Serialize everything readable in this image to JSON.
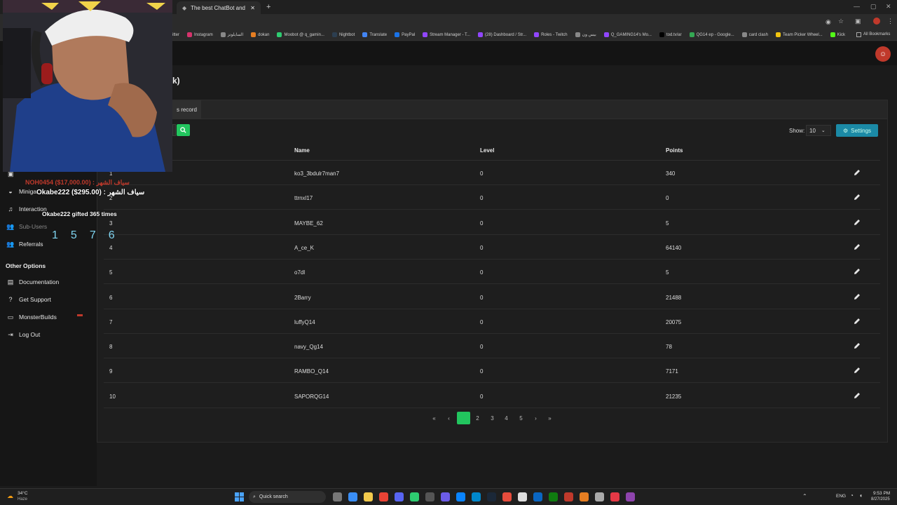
{
  "browser": {
    "tab_title": "The best ChatBot and Widgets",
    "bookmarks": [
      "itter",
      "Instagram",
      "السايلوتز",
      "dokan",
      "Moobot @ q_gamin...",
      "Nightbot",
      "Translate",
      "PayPal",
      "Stream Manager - T...",
      "(28) Dashboard / Str...",
      "Roles - Twitch",
      "بيس ون",
      "Q_GAMING14's Mo...",
      "tod.tv/ar",
      "QG14 ep - Google...",
      "card clash",
      "Team Picker Wheel...",
      "Kick"
    ],
    "all_bookmarks": "All Bookmarks"
  },
  "page": {
    "title_fragment": "k)",
    "tab_fragment": "s record"
  },
  "sidebar": {
    "items": [
      {
        "label": "Minigames",
        "icon": "gamepad-icon"
      },
      {
        "label": "Interaction",
        "icon": "music-icon"
      },
      {
        "label": "Sub-Users",
        "icon": "users-icon"
      },
      {
        "label": "Referrals",
        "icon": "users-icon"
      }
    ],
    "section": "Other Options",
    "other": [
      {
        "label": "Documentation",
        "icon": "book-icon"
      },
      {
        "label": "Get Support",
        "icon": "question-icon"
      },
      {
        "label": "MonsterBuilds",
        "icon": "laptop-icon"
      },
      {
        "label": "Log Out",
        "icon": "logout-icon"
      }
    ]
  },
  "toolbar": {
    "show_label": "Show:",
    "show_value": "10",
    "settings_label": "Settings"
  },
  "table": {
    "headers": {
      "name": "Name",
      "level": "Level",
      "points": "Points"
    },
    "rows": [
      {
        "rank": "1",
        "name": "ko3_3bdulr7man7",
        "level": "0",
        "points": "340"
      },
      {
        "rank": "2",
        "name": "ttrnxl17",
        "level": "0",
        "points": "0"
      },
      {
        "rank": "3",
        "name": "MAYBE_62",
        "level": "0",
        "points": "5"
      },
      {
        "rank": "4",
        "name": "A_ce_K",
        "level": "0",
        "points": "64140"
      },
      {
        "rank": "5",
        "name": "o7dl",
        "level": "0",
        "points": "5"
      },
      {
        "rank": "6",
        "name": "2Barry",
        "level": "0",
        "points": "21488"
      },
      {
        "rank": "7",
        "name": "luffyQ14",
        "level": "0",
        "points": "20075"
      },
      {
        "rank": "8",
        "name": "navy_Qg14",
        "level": "0",
        "points": "78"
      },
      {
        "rank": "9",
        "name": "RAMBO_Q14",
        "level": "0",
        "points": "7171"
      },
      {
        "rank": "10",
        "name": "SAPORQG14",
        "level": "0",
        "points": "21235"
      }
    ]
  },
  "pagination": {
    "first": "«",
    "prev": "‹",
    "pages": [
      "1",
      "2",
      "3",
      "4",
      "5"
    ],
    "current": "1",
    "next": "›",
    "last": "»"
  },
  "overlay": {
    "top_line": "NOH0454 ($17,000.00) : سياف الشهر",
    "main_line": "Okabe222 ($295.00) : سياف الشهر",
    "gifted_line": "Okabe222 gifted 365 times",
    "counter": [
      "1",
      "5",
      "7",
      "6"
    ]
  },
  "taskbar": {
    "weather_temp": "34°C",
    "weather_desc": "Haze",
    "search": "Quick search",
    "lang": "ENG",
    "time": "9:53 PM",
    "date": "8/27/2025"
  },
  "colors": {
    "accent_green": "#22c55e",
    "settings_teal": "#1b8aa6",
    "red_badge": "#c0392b"
  }
}
